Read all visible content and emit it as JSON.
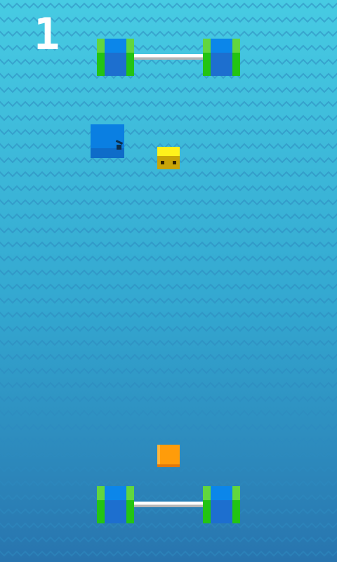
{
  "hud": {
    "score": "1"
  },
  "colors": {
    "water_top": "#47cbe3",
    "water_bottom": "#2874ae",
    "wave_line": "#2e8bc0",
    "post_blue": "#1d6fcf",
    "post_green": "#23c413",
    "enemy_blue": "#0a7fe2",
    "yellow_cube": "#fff21b",
    "player_orange": "#ff9c0a"
  },
  "entities": {
    "goal_top": "goal-posts",
    "goal_bottom": "goal-posts",
    "enemy": "blue-cube-enemy",
    "yellow": "yellow-cube-character",
    "player": "orange-cube-player"
  }
}
